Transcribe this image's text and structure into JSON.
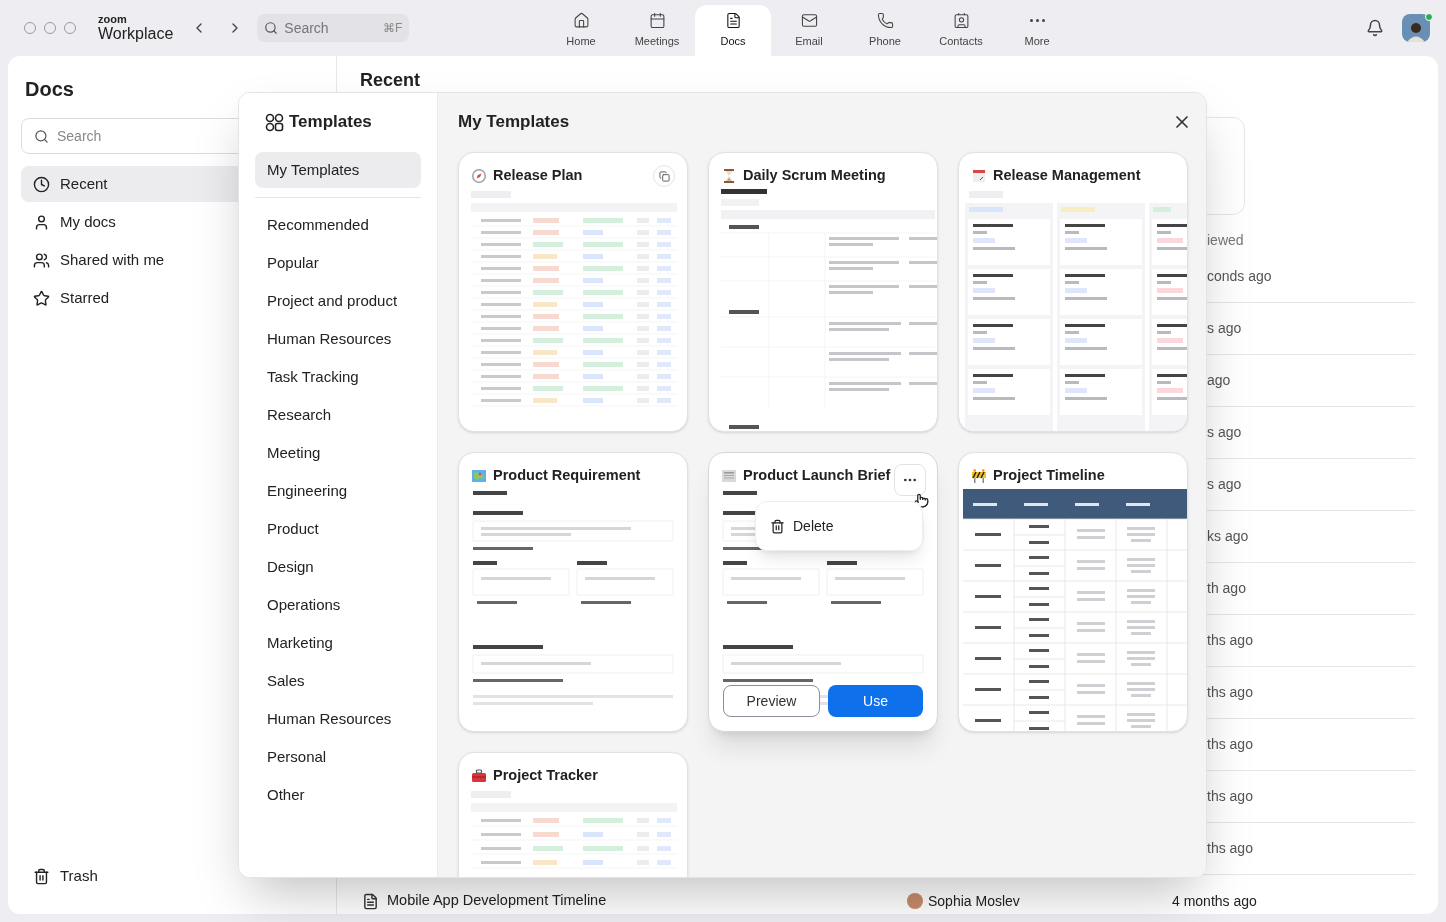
{
  "topbar": {
    "logo_small": "zoom",
    "logo": "Workplace",
    "search": {
      "placeholder": "Search",
      "shortcut": "⌘F"
    },
    "tabs": [
      {
        "label": "Home",
        "selected": false
      },
      {
        "label": "Meetings",
        "selected": false
      },
      {
        "label": "Docs",
        "selected": true
      },
      {
        "label": "Email",
        "selected": false
      },
      {
        "label": "Phone",
        "selected": false
      },
      {
        "label": "Contacts",
        "selected": false
      },
      {
        "label": "More",
        "selected": false
      }
    ],
    "user": {
      "online": true
    }
  },
  "sidebar": {
    "title": "Docs",
    "search": {
      "placeholder": "Search"
    },
    "items": [
      {
        "label": "Recent",
        "selected": true
      },
      {
        "label": "My docs",
        "selected": false
      },
      {
        "label": "Shared with me",
        "selected": false
      },
      {
        "label": "Starred",
        "selected": false
      }
    ],
    "trash": "Trash"
  },
  "content": {
    "title": "Recent",
    "column_header": "iewed",
    "rows": [
      {
        "time": "conds ago"
      },
      {
        "time": "s ago"
      },
      {
        "time": "ago"
      },
      {
        "time": "s ago"
      },
      {
        "time": "s ago"
      },
      {
        "time": "ks ago"
      },
      {
        "time": "th ago"
      },
      {
        "time": "ths ago"
      },
      {
        "time": "ths ago"
      },
      {
        "time": "ths ago"
      },
      {
        "time": "ths ago"
      },
      {
        "time": "ths ago"
      },
      {
        "title": "Mobile App Development Timeline",
        "owner": "Sophia Moslev",
        "time": "4 months ago"
      }
    ]
  },
  "templates": {
    "title": "Templates",
    "pinned": [
      {
        "label": "My Templates",
        "selected": true
      }
    ],
    "categories": [
      {
        "label": "Recommended",
        "selected": false
      },
      {
        "label": "Popular",
        "selected": false
      },
      {
        "label": "Project and product",
        "selected": false
      },
      {
        "label": "Human Resources",
        "selected": false
      },
      {
        "label": "Task Tracking",
        "selected": false
      },
      {
        "label": "Research",
        "selected": false
      },
      {
        "label": "Meeting",
        "selected": false
      },
      {
        "label": "Engineering",
        "selected": false
      },
      {
        "label": "Product",
        "selected": false
      },
      {
        "label": "Design",
        "selected": false
      },
      {
        "label": "Operations",
        "selected": false
      },
      {
        "label": "Marketing",
        "selected": false
      },
      {
        "label": "Sales",
        "selected": false
      },
      {
        "label": "Human Resources",
        "selected": false
      },
      {
        "label": "Personal",
        "selected": false
      },
      {
        "label": "Other",
        "selected": false
      }
    ],
    "heading": "My Templates",
    "cards": [
      {
        "kind": "plan",
        "title": "Release Plan",
        "copy_button": true
      },
      {
        "kind": "log",
        "title": "Daily Scrum Meeting"
      },
      {
        "kind": "board",
        "title": "Release Management"
      },
      {
        "kind": "doc",
        "title": "Product Requirement"
      },
      {
        "kind": "doc",
        "title": "Product Launch Brief",
        "hovered": true,
        "menu_open": true,
        "menu": [
          {
            "label": "Delete"
          }
        ],
        "actions": [
          "Preview",
          "Use"
        ]
      },
      {
        "kind": "grid",
        "title": "Project Timeline"
      },
      {
        "kind": "tracker",
        "title": "Project Tracker"
      }
    ]
  }
}
